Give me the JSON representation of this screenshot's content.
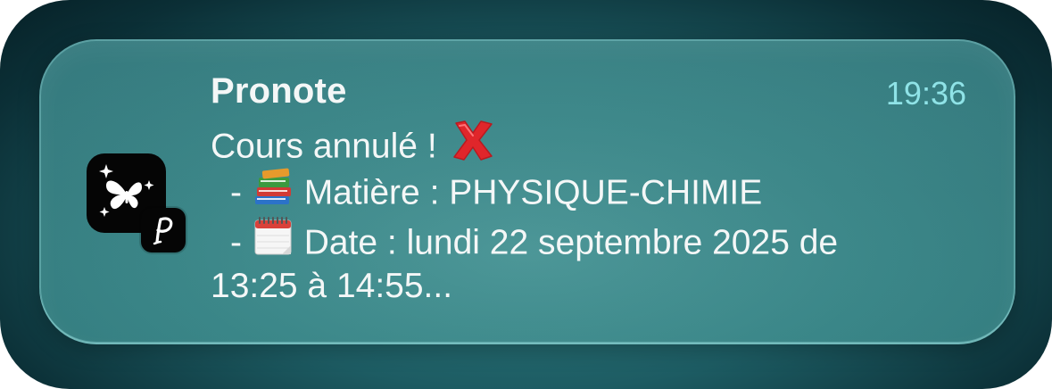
{
  "notification": {
    "app_name": "Pronote",
    "timestamp": "19:36",
    "title_line": "Cours annulé !",
    "subject_prefix": "-",
    "subject_text": "Matière : PHYSIQUE-CHIMIE",
    "date_prefix": "-",
    "date_text": "Date : lundi 22 septembre 2025 de",
    "date_continuation": "13:25 à 14:55..."
  },
  "icons": {
    "app_icon": "butterfly-sparkles-icon",
    "badge_icon": "pronote-p-icon",
    "cancel_icon": "red-cross-mark-icon",
    "subject_icon": "books-icon",
    "date_icon": "calendar-icon"
  },
  "colors": {
    "timestamp": "#8fe3e7",
    "text": "#f4f7f7",
    "card": "#3a8486",
    "cross": "#e0262b"
  }
}
